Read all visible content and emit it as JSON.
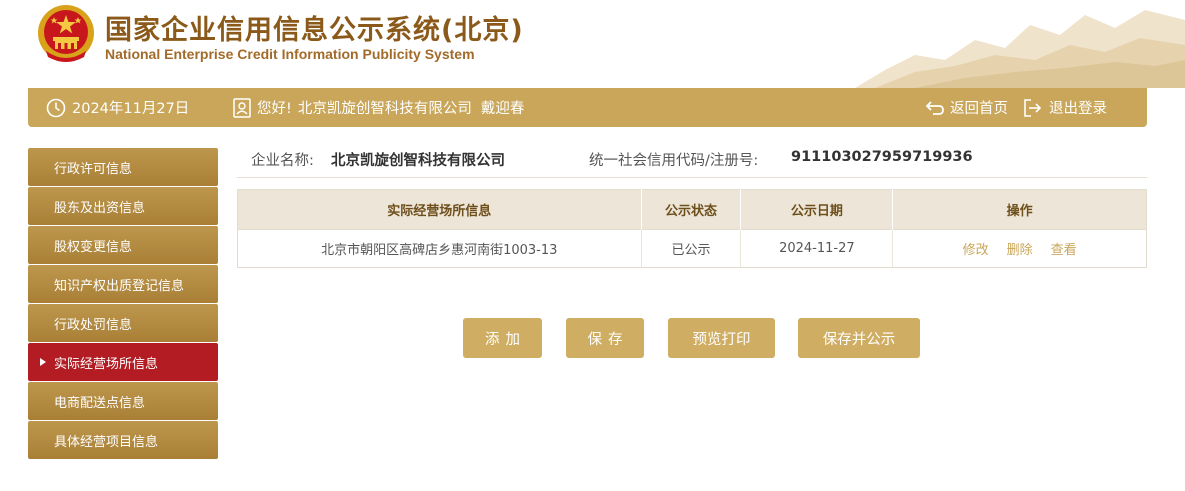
{
  "header": {
    "title_cn": "国家企业信用信息公示系统(北京)",
    "title_en": "National Enterprise Credit Information Publicity System"
  },
  "infobar": {
    "date": "2024年11月27日",
    "greeting": "您好!",
    "company": "北京凯旋创智科技有限公司",
    "user": "戴迎春",
    "home_label": "返回首页",
    "logout_label": "退出登录"
  },
  "sidebar": {
    "items": [
      {
        "label": "行政许可信息"
      },
      {
        "label": "股东及出资信息"
      },
      {
        "label": "股权变更信息"
      },
      {
        "label": "知识产权出质登记信息"
      },
      {
        "label": "行政处罚信息"
      },
      {
        "label": "实际经营场所信息"
      },
      {
        "label": "电商配送点信息"
      },
      {
        "label": "具体经营项目信息"
      }
    ]
  },
  "company_info": {
    "name_label": "企业名称:",
    "name_value": "北京凯旋创智科技有限公司",
    "code_label": "统一社会信用代码/注册号:",
    "code_value": "911103027959719936"
  },
  "table": {
    "columns": [
      "实际经营场所信息",
      "公示状态",
      "公示日期",
      "操作"
    ],
    "rows": [
      {
        "address": "北京市朝阳区高碑店乡惠河南街1003-13",
        "status": "已公示",
        "date": "2024-11-27",
        "ops": [
          "修改",
          "删除",
          "查看"
        ]
      }
    ]
  },
  "buttons": {
    "add": "添加",
    "save": "保存",
    "preview_print": "预览打印",
    "save_publish": "保存并公示"
  },
  "colors": {
    "gold": "#c9a659",
    "active_red": "#b21c22",
    "title_brown": "#8b5a1a"
  }
}
